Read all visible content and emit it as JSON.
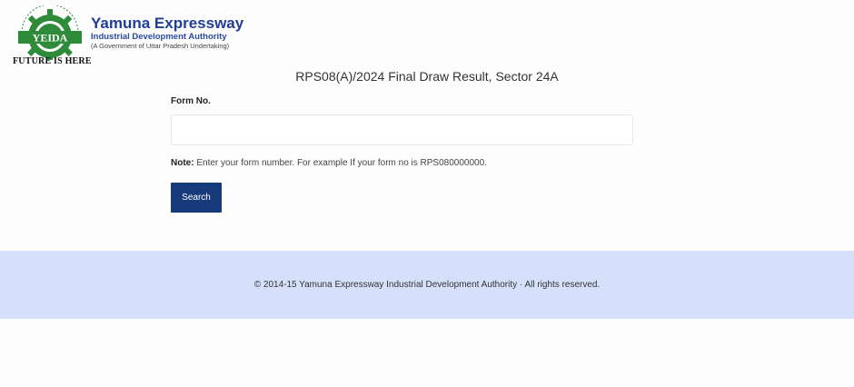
{
  "header": {
    "org_name": "Yamuna Expressway",
    "org_subtitle": "Industrial Development Authority",
    "org_government": "(A Government of Uttar Pradesh Undertaking)",
    "logo_text": "YEIDA",
    "tagline": "FUTURE IS HERE",
    "colors": {
      "emblem_green": "#2e8b3a",
      "org_blue": "#1f3e94"
    }
  },
  "page": {
    "title": "RPS08(A)/2024 Final Draw Result, Sector 24A"
  },
  "form": {
    "label": "Form No.",
    "input_value": "",
    "input_placeholder": "",
    "note_label": "Note:",
    "note_text": "Enter your form number. For example If your form no is RPS080000000.",
    "search_label": "Search",
    "button_color": "#163a7a"
  },
  "footer": {
    "text": "© 2014-15 Yamuna Expressway Industrial Development Authority · All rights reserved.",
    "background": "#d6e0fb"
  }
}
